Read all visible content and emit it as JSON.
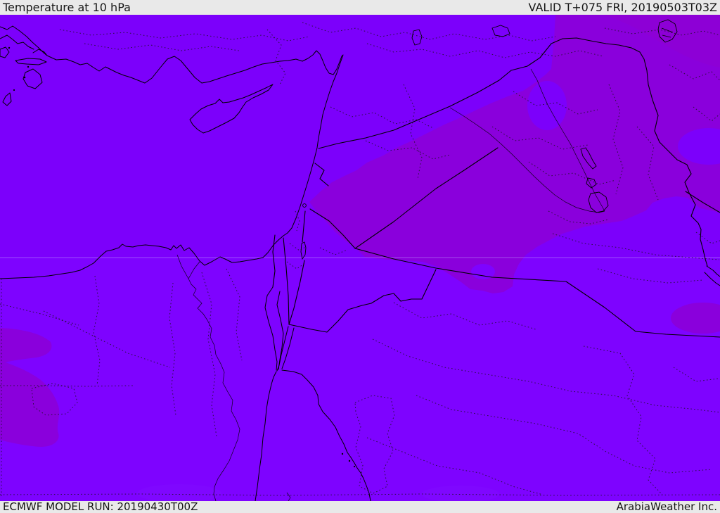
{
  "header": {
    "title": "Temperature at 10 hPa",
    "valid_time": "VALID T+075 FRI, 20190503T03Z"
  },
  "footer": {
    "model_run": "ECMWF MODEL RUN: 20190430T00Z",
    "brand": "ArabiaWeather Inc."
  },
  "map": {
    "palette": {
      "base_violet": "#7C00FB",
      "lower_band_violet": "#7E03FF",
      "warm_violet": "#8A00DC",
      "corner_violet": "#8D00D6",
      "bar_background": "#E9E9E9",
      "line_black": "#000000"
    }
  }
}
